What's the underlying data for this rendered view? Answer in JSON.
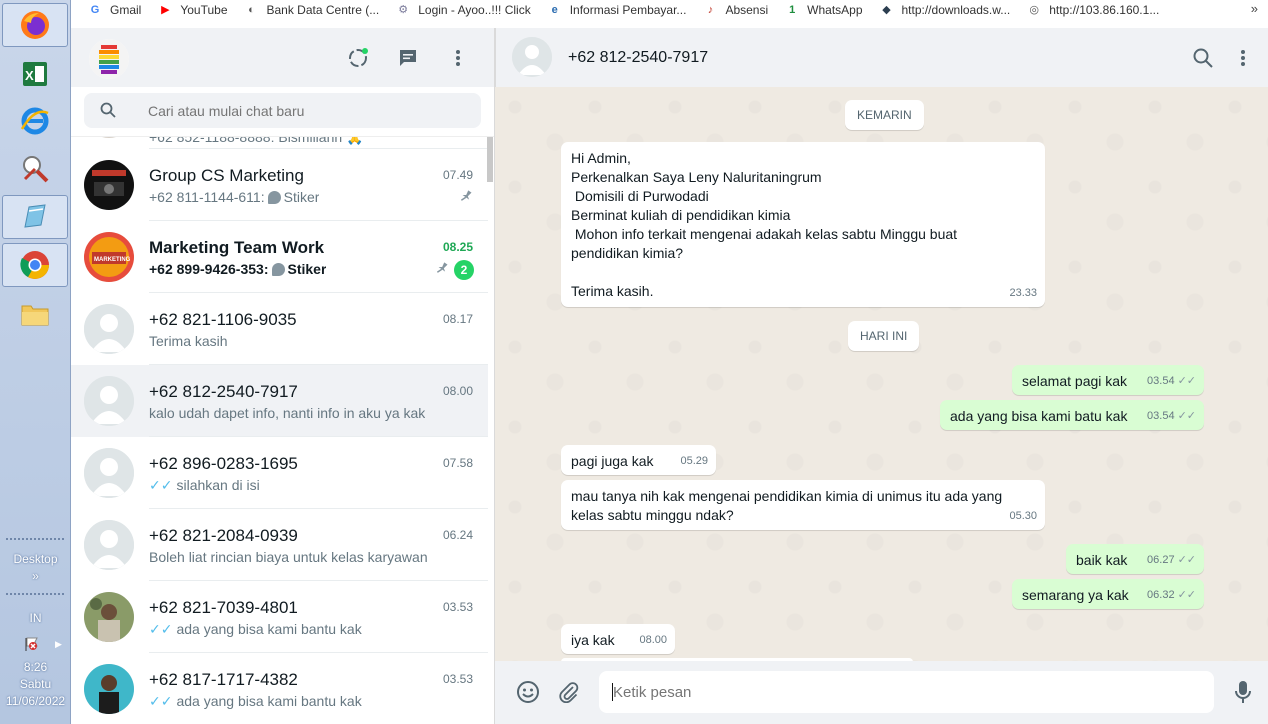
{
  "taskbar": {
    "apps": [
      "firefox-icon",
      "excel-icon",
      "internet-explorer-icon",
      "tools-icon",
      "notepad-icon",
      "chrome-icon",
      "folder-icon"
    ],
    "desktop_label": "Desktop",
    "desktop_chevron": "»",
    "lang": "IN",
    "clock_time": "8:26",
    "clock_day": "Sabtu",
    "clock_date": "11/06/2022"
  },
  "bookmarks": [
    {
      "label": "Gmail",
      "icon": "G",
      "color": "#4285f4"
    },
    {
      "label": "YouTube",
      "icon": "▶",
      "color": "#ff0000"
    },
    {
      "label": "Bank Data Centre (...",
      "icon": "◐",
      "color": "#555555"
    },
    {
      "label": "Login - Ayoo..!!! Click",
      "icon": "⚙",
      "color": "#7a7a9a"
    },
    {
      "label": "Informasi Pembayar...",
      "icon": "e",
      "color": "#2b6cb0"
    },
    {
      "label": "Absensi",
      "icon": "♪",
      "color": "#c0392b"
    },
    {
      "label": "WhatsApp",
      "icon": "1",
      "color": "#1e8e3e"
    },
    {
      "label": "http://downloads.w...",
      "icon": "◆",
      "color": "#2c3e50"
    },
    {
      "label": "http://103.86.160.1...",
      "icon": "◎",
      "color": "#555555"
    }
  ],
  "bookmarks_more": "»",
  "search": {
    "placeholder": "Cari atau mulai chat baru"
  },
  "partial_row": "+62 852-1188-8888: Bismillahh 🙏",
  "chats": [
    {
      "name": "Group CS Marketing",
      "time": "07.49",
      "sender": "+62 811-1144-611:",
      "msg": "Stiker",
      "sticker": true,
      "pinned": true,
      "bold": false,
      "unread": ""
    },
    {
      "name": "Marketing Team Work",
      "time": "08.25",
      "sender": "+62 899-9426-353:",
      "msg": "Stiker",
      "sticker": true,
      "pinned": true,
      "bold": true,
      "unread": "2"
    },
    {
      "name": "+62 821-1106-9035",
      "time": "08.17",
      "sender": "",
      "msg": "Terima kasih",
      "sticker": false,
      "pinned": false,
      "bold": false,
      "unread": ""
    },
    {
      "name": "+62 812-2540-7917",
      "time": "08.00",
      "sender": "",
      "msg": "kalo udah dapet info, nanti info in aku ya kak",
      "sticker": false,
      "pinned": false,
      "bold": false,
      "unread": "",
      "selected": true
    },
    {
      "name": "+62 896-0283-1695",
      "time": "07.58",
      "sender": "",
      "msg": "silahkan di isi",
      "tick": true,
      "sticker": false,
      "pinned": false,
      "bold": false,
      "unread": ""
    },
    {
      "name": "+62 821-2084-0939",
      "time": "06.24",
      "sender": "",
      "msg": "Boleh liat rincian biaya untuk kelas karyawan",
      "sticker": false,
      "pinned": false,
      "bold": false,
      "unread": ""
    },
    {
      "name": "+62 821-7039-4801",
      "time": "03.53",
      "sender": "",
      "msg": "ada yang bisa kami bantu kak",
      "tick": true,
      "sticker": false,
      "pinned": false,
      "bold": false,
      "unread": ""
    },
    {
      "name": "+62 817-1717-4382",
      "time": "03.53",
      "sender": "",
      "msg": "ada yang bisa kami bantu kak",
      "tick": true,
      "sticker": false,
      "pinned": false,
      "bold": false,
      "unread": ""
    }
  ],
  "conversation": {
    "contact": "+62 812-2540-7917",
    "chip_yesterday": "KEMARIN",
    "chip_today": "HARI INI",
    "messages": [
      {
        "dir": "in",
        "text": "Hi Admin,\nPerkenalkan Saya Leny Naluritaningrum\n Domisili di Purwodadi\nBerminat kuliah di pendidikan kimia\n Mohon info terkait mengenai adakah kelas sabtu Minggu buat\npendidikan kimia?\n\nTerima kasih.",
        "time": "23.33"
      },
      {
        "dir": "out",
        "text": "selamat pagi kak",
        "time": "03.54"
      },
      {
        "dir": "out",
        "text": "ada yang bisa kami batu kak",
        "time": "03.54"
      },
      {
        "dir": "in",
        "text": "pagi juga kak",
        "time": "05.29"
      },
      {
        "dir": "in",
        "text": "mau tanya nih kak mengenai pendidikan kimia di unimus itu ada yang\nkelas sabtu minggu ndak?",
        "time": "05.30"
      },
      {
        "dir": "out",
        "text": "baik kak",
        "time": "06.27"
      },
      {
        "dir": "out",
        "text": "semarang ya kak",
        "time": "06.32"
      },
      {
        "dir": "in",
        "text": "iya kak",
        "time": "08.00"
      }
    ],
    "double_tick": "✓✓"
  },
  "composer": {
    "placeholder": "Ketik pesan"
  },
  "colors": {
    "accent": "#25d366",
    "out_bubble": "#d9fdd3",
    "bg": "#efeae2"
  }
}
